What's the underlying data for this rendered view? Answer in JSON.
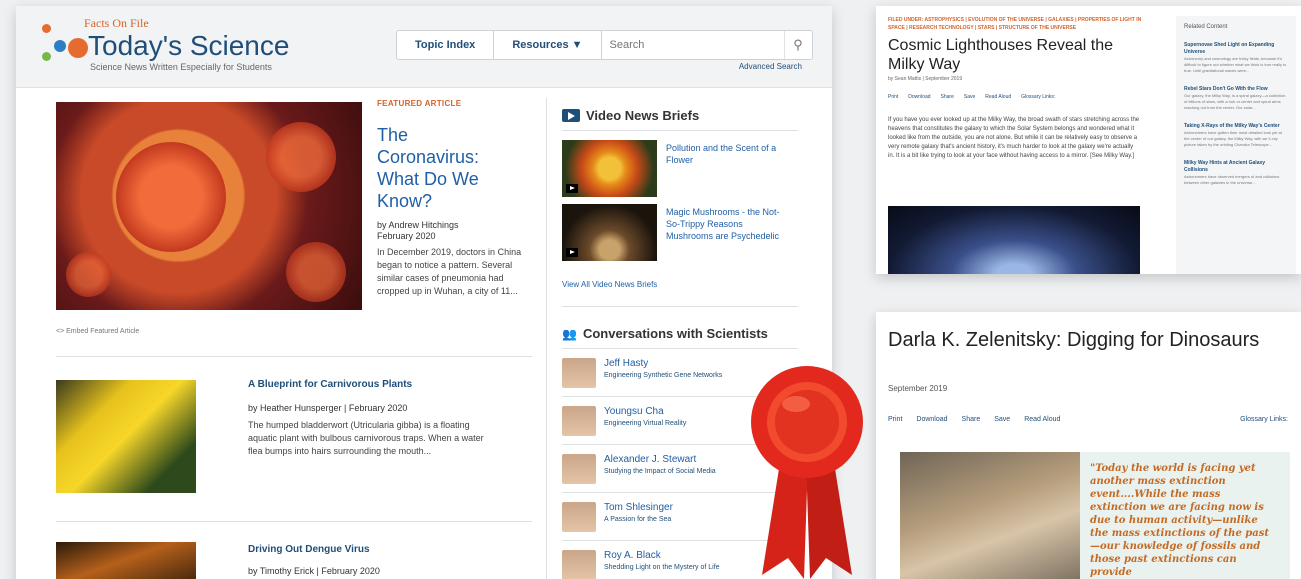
{
  "header": {
    "brand_small": "Facts On File",
    "brand_title": "Today's Science",
    "tagline": "Science News Written Especially for Students",
    "nav": [
      "Topic Index",
      "Resources ▼"
    ],
    "search_placeholder": "Search",
    "advanced_search": "Advanced Search"
  },
  "featured": {
    "label": "FEATURED ARTICLE",
    "title": "The Coronavirus: What Do We Know?",
    "author": "by Andrew Hitchings",
    "date": "February 2020",
    "summary": "In December 2019, doctors in China began to notice a pattern. Several similar cases of pneumonia had cropped up in Wuhan, a city of 11...",
    "embed": "<> Embed Featured Article"
  },
  "articles": [
    {
      "title": "A Blueprint for Carnivorous Plants",
      "meta": "by Heather Hunsperger | February 2020",
      "summary": "The humped bladderwort (Utricularia gibba) is a floating aquatic plant with bulbous carnivorous traps. When a water flea bumps into hairs surrounding the mouth..."
    },
    {
      "title": "Driving Out Dengue Virus",
      "meta": "by Timothy Erick | February 2020",
      "summary": ""
    }
  ],
  "video": {
    "heading": "Video News Briefs",
    "items": [
      {
        "title": "Pollution and the Scent of a Flower"
      },
      {
        "title": "Magic Mushrooms - the Not-So-Trippy Reasons Mushrooms are Psychedelic"
      }
    ],
    "view_all": "View All Video News Briefs"
  },
  "conversations": {
    "heading": "Conversations with Scientists",
    "items": [
      {
        "name": "Jeff Hasty",
        "topic": "Engineering Synthetic Gene Networks"
      },
      {
        "name": "Youngsu Cha",
        "topic": "Engineering Virtual Reality"
      },
      {
        "name": "Alexander J. Stewart",
        "topic": "Studying the Impact of Social Media"
      },
      {
        "name": "Tom Shlesinger",
        "topic": "A Passion for the Sea"
      },
      {
        "name": "Roy A. Black",
        "topic": "Shedding Light on the Mystery of Life"
      }
    ]
  },
  "article1": {
    "filed": "FILED UNDER: ASTROPHYSICS | EVOLUTION OF THE UNIVERSE | GALAXIES | PROPERTIES OF LIGHT IN SPACE | RESEARCH TECHNOLOGY | STARS | STRUCTURE OF THE UNIVERSE",
    "title": "Cosmic Lighthouses Reveal the Milky Way",
    "byline": "by Sean Mattis | September 2019",
    "tools": [
      "Print",
      "Download",
      "Share",
      "Save",
      "Read Aloud",
      "Glossary Links:"
    ],
    "body": "If you have you ever looked up at the Milky Way, the broad swath of stars stretching across the heavens that constitutes the galaxy to which the Solar System belongs and wondered what it looked like from the outside, you are not alone. But while it can be relatively easy to observe a very remote galaxy that's ancient history, it's much harder to look at the galaxy we're actually in. It is a bit like trying to look at your face without having access to a mirror. [See Milky Way.]",
    "related_heading": "Related Content",
    "related": [
      {
        "title": "Supernovae Shed Light on Expanding Universe",
        "snippet": "Astronomy and cosmology are tricky fields, because it's difficult to figure out whether what we think is true really is true. Until gravitational waves were..."
      },
      {
        "title": "Rebel Stars Don't Go With the Flow",
        "snippet": "Our galaxy, the Milky Way, is a spiral galaxy—a collection of billions of stars, with a hub or center and spiral arms reaching out from the center. Our solar..."
      },
      {
        "title": "Taking X-Rays of the Milky Way's Center",
        "snippet": "Astronomers have gotten their most detailed look yet at the center of our galaxy, the Milky Way, with an X-ray picture taken by the orbiting Chandra Telescope..."
      },
      {
        "title": "Milky Way Hints at Ancient Galaxy Collisions",
        "snippet": "Astronomers have observed mergers of and collisions between other galaxies in the universe..."
      }
    ]
  },
  "article2": {
    "title": "Darla K. Zelenitsky: Digging for Dinosaurs",
    "date": "September 2019",
    "tools": [
      "Print",
      "Download",
      "Share",
      "Save",
      "Read Aloud",
      "Glossary Links:"
    ],
    "quote": "\"Today the world is facing yet another mass extinction event....While the mass extinction we are facing now is due to human activity—unlike the mass extinctions of the past—our knowledge of fossils and those past extinctions can provide"
  }
}
